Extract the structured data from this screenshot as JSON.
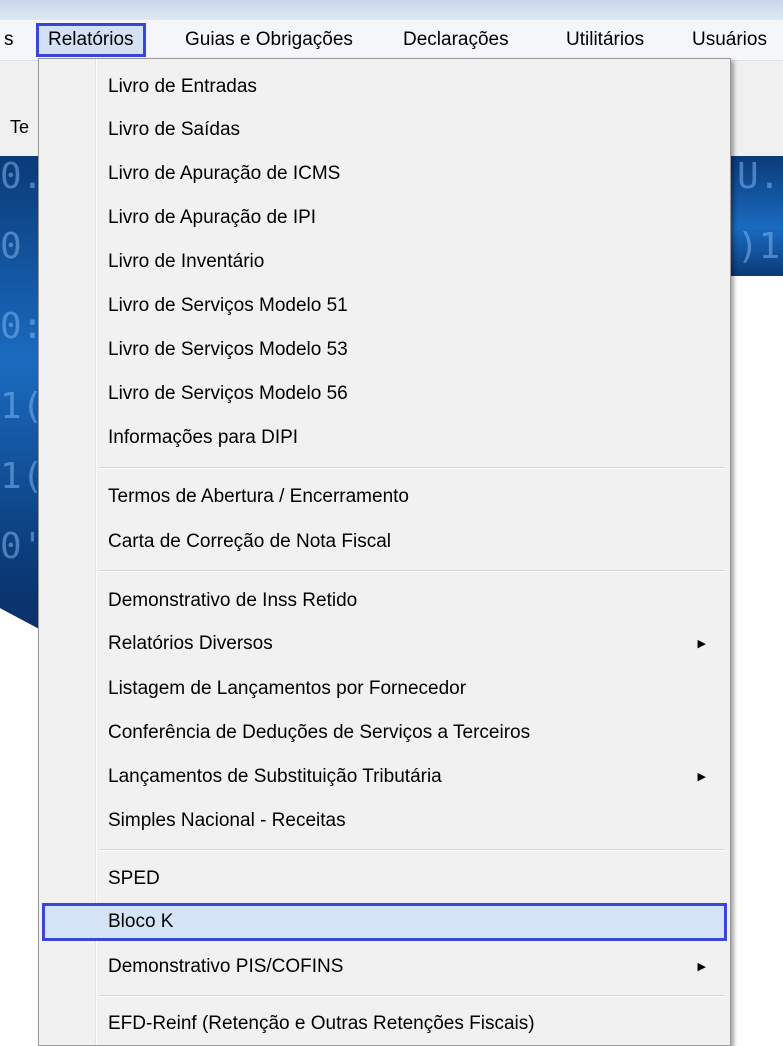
{
  "menubar": {
    "items": [
      {
        "label": "s"
      },
      {
        "label": "Relatórios"
      },
      {
        "label": "Guias e Obrigações"
      },
      {
        "label": "Declarações"
      },
      {
        "label": "Utilitários"
      },
      {
        "label": "Usuários"
      }
    ]
  },
  "toolbar": {
    "partial_label": "Te"
  },
  "background": {
    "digits": [
      "0.",
      "0",
      "0:",
      "1(",
      "1(",
      "0'",
      "U.",
      ")1"
    ]
  },
  "menu": {
    "items": [
      {
        "label": "Livro de Entradas"
      },
      {
        "label": "Livro de Saídas"
      },
      {
        "label": "Livro de Apuração de ICMS"
      },
      {
        "label": "Livro de Apuração de IPI"
      },
      {
        "label": "Livro de Inventário"
      },
      {
        "label": "Livro de Serviços Modelo 51"
      },
      {
        "label": "Livro de Serviços Modelo 53"
      },
      {
        "label": "Livro de Serviços Modelo 56"
      },
      {
        "label": "Informações para DIPI"
      },
      {
        "label": "Termos de Abertura / Encerramento"
      },
      {
        "label": "Carta de Correção de Nota Fiscal"
      },
      {
        "label": "Demonstrativo de Inss Retido"
      },
      {
        "label": "Relatórios Diversos"
      },
      {
        "label": "Listagem de Lançamentos por Fornecedor"
      },
      {
        "label": "Conferência de Deduções de Serviços a Terceiros"
      },
      {
        "label": "Lançamentos de Substituição Tributária"
      },
      {
        "label": "Simples Nacional - Receitas"
      },
      {
        "label": "SPED"
      },
      {
        "label": "Bloco K"
      },
      {
        "label": "Demonstrativo PIS/COFINS"
      },
      {
        "label": "EFD-Reinf (Retenção e Outras Retenções Fiscais)"
      }
    ],
    "submenu_arrow": "▶"
  },
  "colors": {
    "highlight_border": "#3a46d8",
    "selected_bg": "#d4e3f6"
  }
}
